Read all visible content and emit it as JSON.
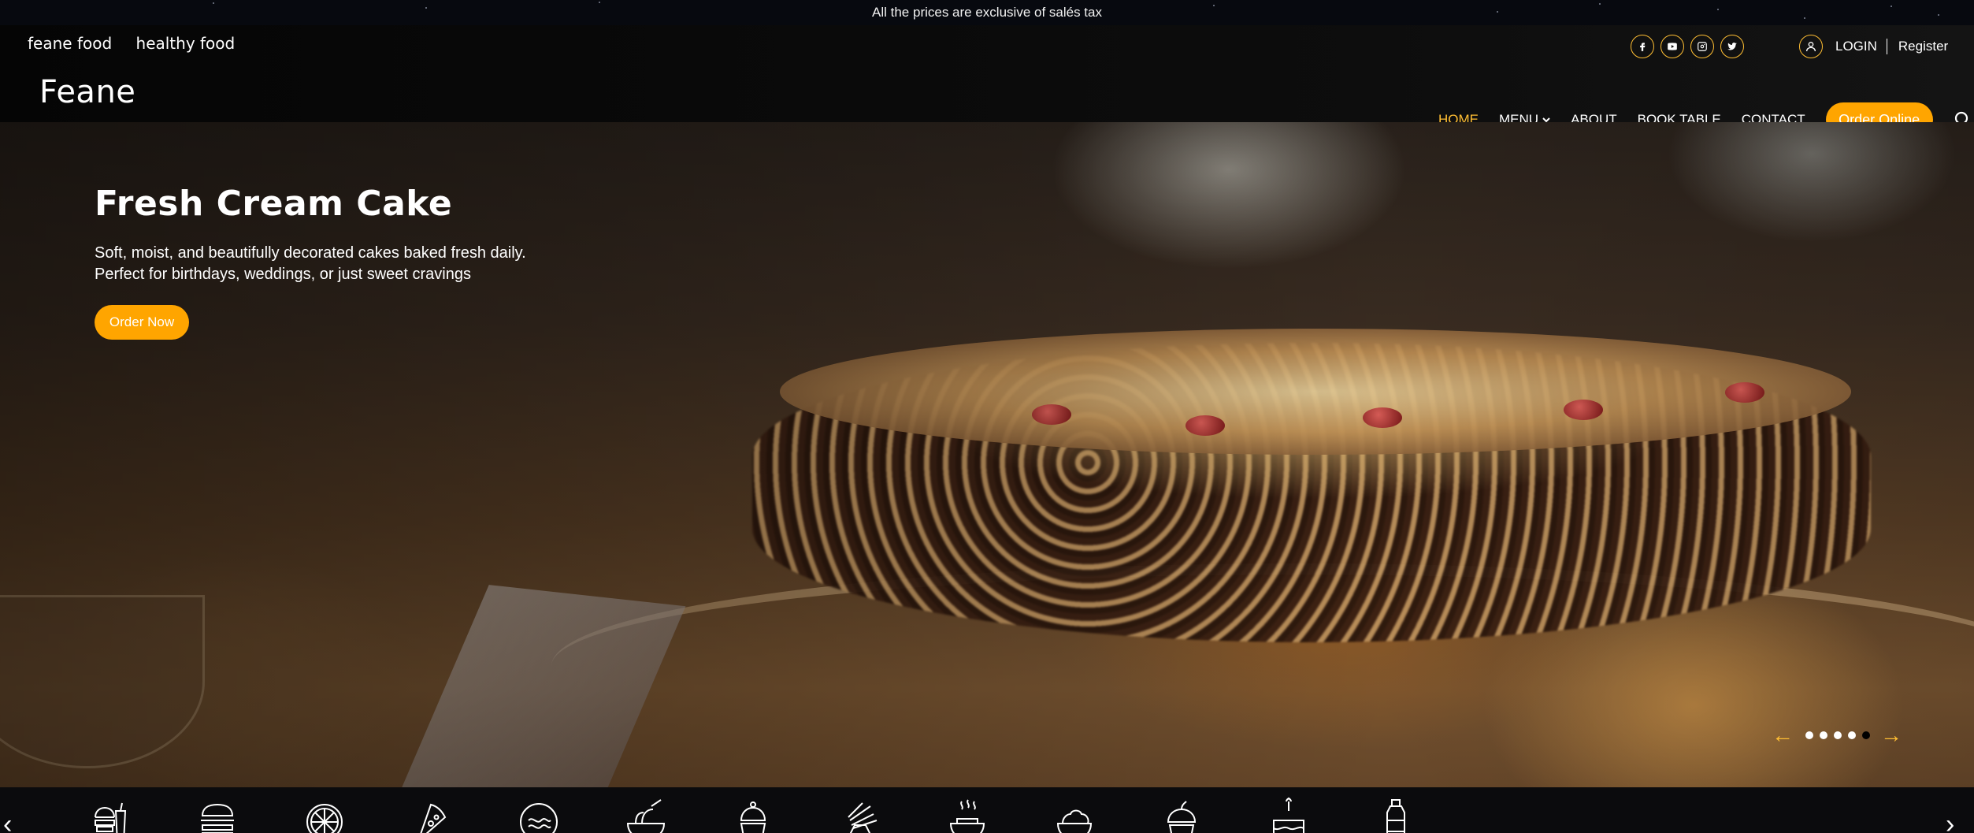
{
  "announcement": {
    "text": "All the prices are exclusive of salés tax"
  },
  "topbar": {
    "tagline_1": "feane food",
    "tagline_2": "healthy food",
    "socials": [
      "facebook-icon",
      "youtube-icon",
      "instagram-icon",
      "twitter-icon"
    ],
    "login": "LOGIN",
    "register": "Register"
  },
  "brand": {
    "logo": "Feane"
  },
  "nav": {
    "items": [
      "HOME",
      "MENU",
      "ABOUT",
      "BOOK TABLE",
      "CONTACT"
    ],
    "active": "HOME",
    "order_online": "Order Online",
    "search_icon": "search-icon"
  },
  "hero": {
    "title": "Fresh Cream Cake",
    "text_line_1": "Soft, moist, and beautifully decorated cakes baked fresh daily.",
    "text_line_2": "Perfect for birthdays, weddings, or just sweet cravings",
    "cta": "Order Now",
    "slide_count": 5,
    "active_slide": 5,
    "prev": "←",
    "next": "→"
  },
  "categories": {
    "prev": "‹",
    "next": "›",
    "icons": [
      "combo-meal-icon",
      "burger-icon",
      "pizza-icon",
      "pizza-slice-icon",
      "pasta-icon",
      "noodles-icon",
      "cupcake-icon",
      "fries-icon",
      "soup-icon",
      "salad-icon",
      "muffin-icon",
      "birthday-cake-icon",
      "drink-bottle-icon"
    ]
  },
  "colors": {
    "accent": "#ffbe33",
    "button": "#ffa500",
    "background": "#0b0b0d"
  }
}
